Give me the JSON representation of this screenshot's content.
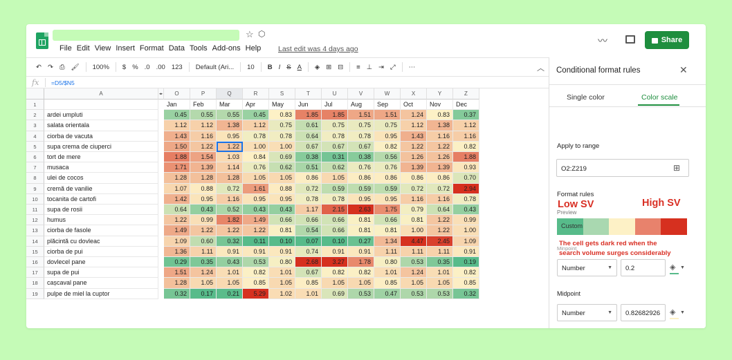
{
  "header": {
    "menu": [
      "File",
      "Edit",
      "View",
      "Insert",
      "Format",
      "Data",
      "Tools",
      "Add-ons",
      "Help"
    ],
    "last_edit": "Last edit was 4 days ago",
    "share_label": "Share"
  },
  "toolbar": {
    "zoom": "100%",
    "currency": "$",
    "percent": "%",
    "dec_less": ".0",
    "dec_more": ".00",
    "more_formats": "123",
    "font": "Default (Ari...",
    "font_size": "10",
    "bold": "B",
    "italic": "I",
    "strike": "S",
    "text_color": "A",
    "more": "⋯"
  },
  "formula_bar": {
    "formula": "=D5/$N5"
  },
  "grid": {
    "columns": [
      "A",
      "O",
      "P",
      "Q",
      "R",
      "S",
      "T",
      "U",
      "V",
      "W",
      "X",
      "Y",
      "Z"
    ],
    "selected_column": "Q",
    "row_numbers": [
      "1",
      "2",
      "3",
      "4",
      "5",
      "6",
      "7",
      "8",
      "9",
      "10",
      "11",
      "12",
      "13",
      "14",
      "15",
      "16",
      "17",
      "18",
      "19"
    ],
    "months": [
      "Jan",
      "Feb",
      "Mar",
      "Apr",
      "May",
      "Jun",
      "Jul",
      "Aug",
      "Sep",
      "Oct",
      "Nov",
      "Dec"
    ],
    "rows": [
      {
        "name": "ardei umpluti",
        "values": [
          "0.45",
          "0.55",
          "0.55",
          "0.45",
          "0.83",
          "1.85",
          "1.85",
          "1.51",
          "1.51",
          "1.24",
          "0.83",
          "0.37"
        ]
      },
      {
        "name": "salata orientala",
        "values": [
          "1.12",
          "1.12",
          "1.38",
          "1.12",
          "0.75",
          "0.61",
          "0.75",
          "0.75",
          "0.75",
          "1.12",
          "1.38",
          "1.12"
        ]
      },
      {
        "name": "ciorba de vacuta",
        "values": [
          "1.43",
          "1.16",
          "0.95",
          "0.78",
          "0.78",
          "0.64",
          "0.78",
          "0.78",
          "0.95",
          "1.43",
          "1.16",
          "1.16"
        ]
      },
      {
        "name": "supa crema de ciuperci",
        "values": [
          "1.50",
          "1.22",
          "1.22",
          "1.00",
          "1.00",
          "0.67",
          "0.67",
          "0.67",
          "0.82",
          "1.22",
          "1.22",
          "0.82"
        ]
      },
      {
        "name": "tort de mere",
        "values": [
          "1.88",
          "1.54",
          "1.03",
          "0.84",
          "0.69",
          "0.38",
          "0.31",
          "0.38",
          "0.56",
          "1.26",
          "1.26",
          "1.88"
        ]
      },
      {
        "name": "musaca",
        "values": [
          "1.71",
          "1.39",
          "1.14",
          "0.76",
          "0.62",
          "0.51",
          "0.62",
          "0.76",
          "0.76",
          "1.39",
          "1.39",
          "0.93"
        ]
      },
      {
        "name": "ulei de cocos",
        "values": [
          "1.28",
          "1.28",
          "1.28",
          "1.05",
          "1.05",
          "0.86",
          "1.05",
          "0.86",
          "0.86",
          "0.86",
          "0.86",
          "0.70"
        ]
      },
      {
        "name": "cremă de vanilie",
        "values": [
          "1.07",
          "0.88",
          "0.72",
          "1.61",
          "0.88",
          "0.72",
          "0.59",
          "0.59",
          "0.59",
          "0.72",
          "0.72",
          "2.94"
        ]
      },
      {
        "name": "tocanita de cartofi",
        "values": [
          "1.42",
          "0.95",
          "1.16",
          "0.95",
          "0.95",
          "0.78",
          "0.78",
          "0.95",
          "0.95",
          "1.16",
          "1.16",
          "0.78"
        ]
      },
      {
        "name": "supa de rosii",
        "values": [
          "0.64",
          "0.43",
          "0.52",
          "0.43",
          "0.43",
          "1.17",
          "2.15",
          "2.63",
          "1.75",
          "0.79",
          "0.64",
          "0.43"
        ]
      },
      {
        "name": "humus",
        "values": [
          "1.22",
          "0.99",
          "1.82",
          "1.49",
          "0.66",
          "0.66",
          "0.66",
          "0.81",
          "0.66",
          "0.81",
          "1.22",
          "0.99"
        ]
      },
      {
        "name": "ciorba de fasole",
        "values": [
          "1.49",
          "1.22",
          "1.22",
          "1.22",
          "0.81",
          "0.54",
          "0.66",
          "0.81",
          "0.81",
          "1.00",
          "1.22",
          "1.00"
        ]
      },
      {
        "name": "plăcintă cu dovleac",
        "values": [
          "1.09",
          "0.60",
          "0.32",
          "0.11",
          "0.10",
          "0.07",
          "0.10",
          "0.27",
          "1.34",
          "4.47",
          "2.45",
          "1.09"
        ]
      },
      {
        "name": "ciorba de pui",
        "values": [
          "1.36",
          "1.11",
          "0.91",
          "0.91",
          "0.91",
          "0.74",
          "0.91",
          "0.91",
          "1.11",
          "1.11",
          "1.11",
          "0.91"
        ]
      },
      {
        "name": "dovlecel pane",
        "values": [
          "0.29",
          "0.35",
          "0.43",
          "0.53",
          "0.80",
          "2.68",
          "3.27",
          "1.78",
          "0.80",
          "0.53",
          "0.35",
          "0.19"
        ]
      },
      {
        "name": "supa de pui",
        "values": [
          "1.51",
          "1.24",
          "1.01",
          "0.82",
          "1.01",
          "0.67",
          "0.82",
          "0.82",
          "1.01",
          "1.24",
          "1.01",
          "0.82"
        ]
      },
      {
        "name": "cașcaval pane",
        "values": [
          "1.28",
          "1.05",
          "1.05",
          "0.85",
          "1.05",
          "0.85",
          "1.05",
          "1.05",
          "0.85",
          "1.05",
          "1.05",
          "0.85"
        ]
      },
      {
        "name": "pulpe de miel la cuptor",
        "values": [
          "0.32",
          "0.17",
          "0.21",
          "5.29",
          "1.02",
          "1.01",
          "0.69",
          "0.53",
          "0.47",
          "0.53",
          "0.53",
          "0.32"
        ]
      }
    ]
  },
  "panel": {
    "title": "Conditional format rules",
    "tab_single": "Single color",
    "tab_scale": "Color scale",
    "apply_label": "Apply to range",
    "range": "O2:Z219",
    "format_rules_label": "Format rules",
    "low_sv": "Low SV",
    "high_sv": "High SV",
    "preview_label": "Preview",
    "preview_text": "Custom",
    "preview_colors": [
      "#57bb8a",
      "#a9d8b0",
      "#fdf1c6",
      "#e8826c",
      "#d6301f"
    ],
    "note_line1": "The cell gets dark red when the",
    "note_line2": "search volume  surges considerably",
    "minpoint_label": "Minpoint",
    "minpoint_type": "Number",
    "minpoint_value": "0.2",
    "minpoint_color": "#57bb8a",
    "midpoint_label": "Midpoint",
    "midpoint_type": "Number",
    "midpoint_value": "0.82682926",
    "midpoint_color": "#fdf1c6"
  },
  "colors": {
    "low": "#57bb8a",
    "mid": "#fdf1c6",
    "high": "#d6301f",
    "accent": "#1e8e3e"
  }
}
